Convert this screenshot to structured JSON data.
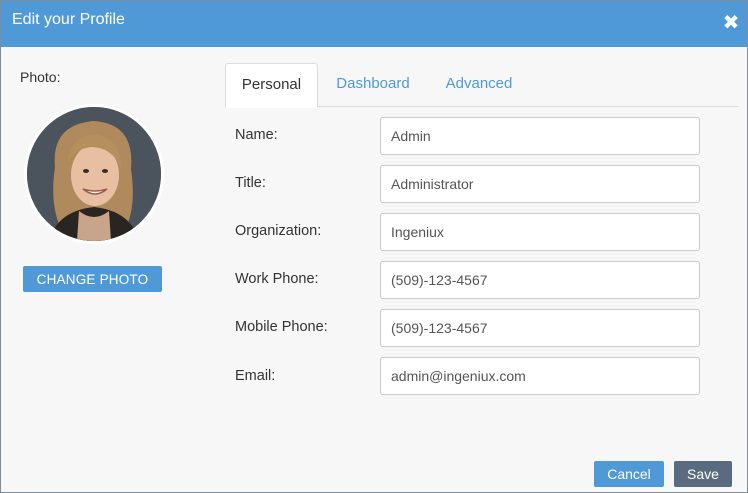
{
  "dialog": {
    "title": "Edit your Profile",
    "close_icon": "close-icon"
  },
  "photo": {
    "label": "Photo:",
    "change_button": "CHANGE PHOTO"
  },
  "tabs": [
    {
      "label": "Personal",
      "active": true
    },
    {
      "label": "Dashboard",
      "active": false
    },
    {
      "label": "Advanced",
      "active": false
    }
  ],
  "form": {
    "name": {
      "label": "Name:",
      "value": "Admin"
    },
    "title": {
      "label": "Title:",
      "value": "Administrator"
    },
    "organization": {
      "label": "Organization:",
      "value": "Ingeniux"
    },
    "work_phone": {
      "label": "Work Phone:",
      "value": "(509)-123-4567"
    },
    "mobile_phone": {
      "label": "Mobile Phone:",
      "value": "(509)-123-4567"
    },
    "email": {
      "label": "Email:",
      "value": "admin@ingeniux.com"
    }
  },
  "footer": {
    "cancel": "Cancel",
    "save": "Save"
  },
  "colors": {
    "accent": "#4f9ad6",
    "save_button": "#5a6b80",
    "background": "#f7f7f7"
  }
}
